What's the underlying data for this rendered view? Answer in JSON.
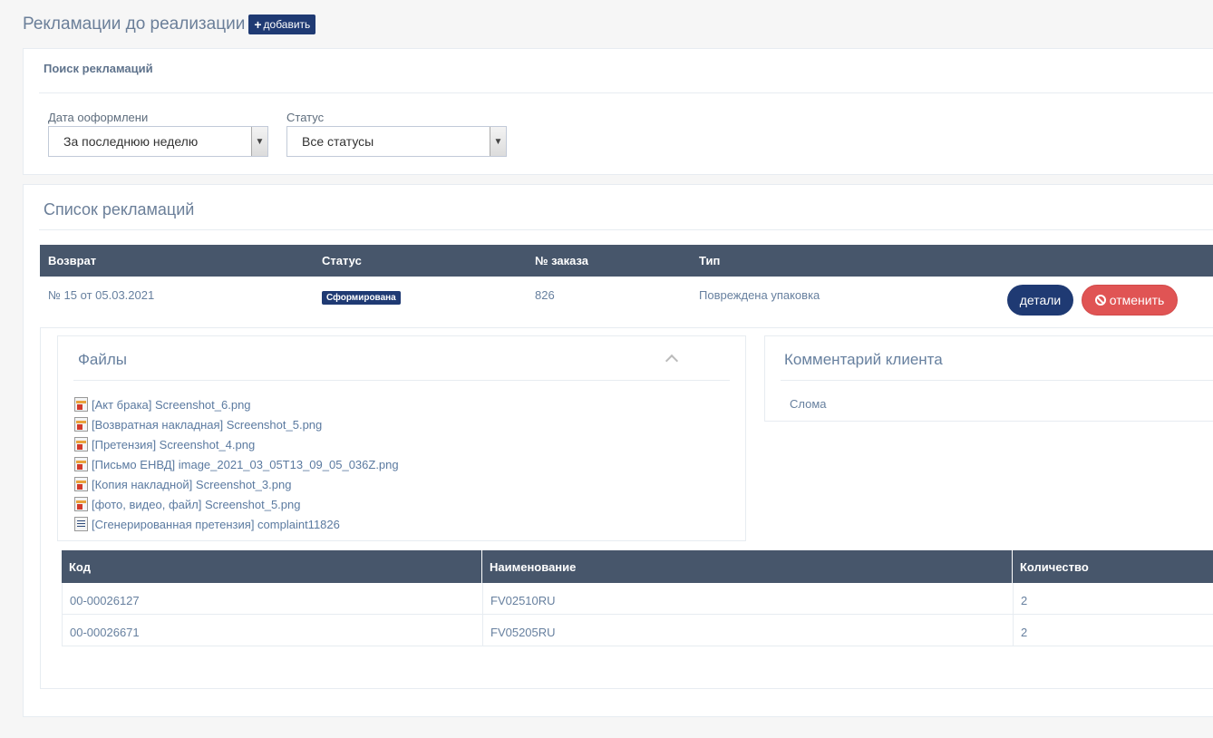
{
  "header": {
    "title": "Рекламации до реализации",
    "add_label": "добавить"
  },
  "search": {
    "title": "Поиск рекламаций",
    "date_label": "Дата ооформлени",
    "date_value": "За последнюю неделю",
    "status_label": "Статус",
    "status_value": "Все статусы"
  },
  "list": {
    "title": "Список рекламаций",
    "columns": [
      "Возврат",
      "Статус",
      "№ заказа",
      "Тип"
    ],
    "row": {
      "return": "№ 15 от 05.03.2021",
      "status": "Сформирована",
      "order": "826",
      "type": "Повреждена упаковка",
      "details_label": "детали",
      "cancel_label": "отменить"
    }
  },
  "files": {
    "title": "Файлы",
    "items": [
      {
        "icon": "image-file-icon",
        "label": "[Акт брака] Screenshot_6.png"
      },
      {
        "icon": "image-file-icon",
        "label": "[Возвратная накладная] Screenshot_5.png"
      },
      {
        "icon": "image-file-icon",
        "label": "[Претензия] Screenshot_4.png"
      },
      {
        "icon": "image-file-icon",
        "label": "[Письмо ЕНВД] image_2021_03_05T13_09_05_036Z.png"
      },
      {
        "icon": "image-file-icon",
        "label": "[Копия накладной] Screenshot_3.png"
      },
      {
        "icon": "image-file-icon",
        "label": "[фото, видео, файл] Screenshot_5.png"
      },
      {
        "icon": "document-file-icon",
        "label": "[Сгенерированная претензия] complaint11826"
      }
    ]
  },
  "comment": {
    "title": "Комментарий клиента",
    "text": "Слома"
  },
  "items": {
    "columns": [
      "Код",
      "Наименование",
      "Количество"
    ],
    "rows": [
      {
        "code": "00-00026127",
        "name": "FV02510RU",
        "qty": "2"
      },
      {
        "code": "00-00026671",
        "name": "FV05205RU",
        "qty": "2"
      }
    ]
  },
  "colors": {
    "primary": "#1f3a73",
    "danger": "#e05454",
    "table_header": "#47566b"
  }
}
